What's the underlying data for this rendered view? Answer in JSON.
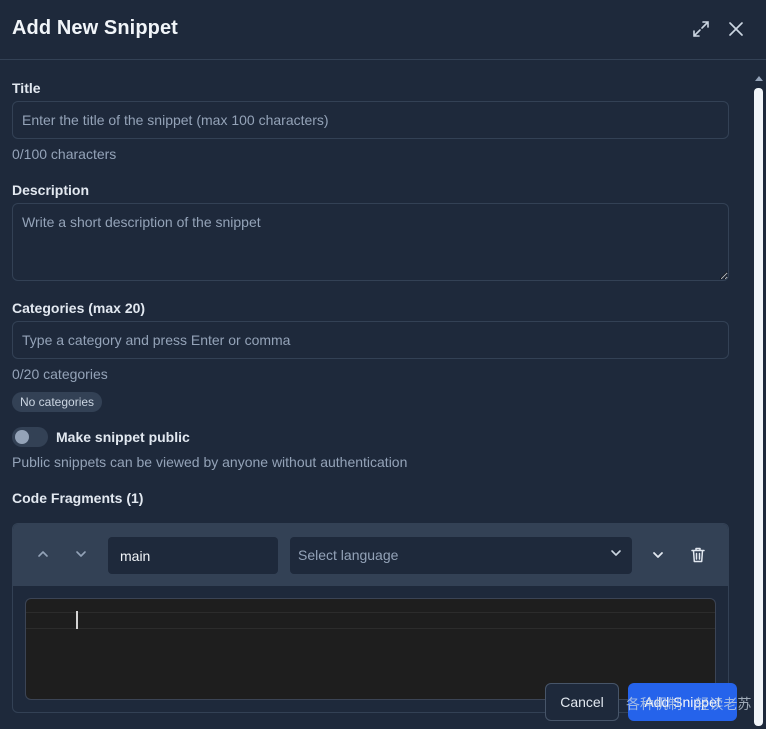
{
  "modal": {
    "title": "Add New Snippet"
  },
  "fields": {
    "title": {
      "label": "Title",
      "value": "",
      "placeholder": "Enter the title of the snippet (max 100 characters)",
      "counter": "0/100 characters"
    },
    "description": {
      "label": "Description",
      "value": "",
      "placeholder": "Write a short description of the snippet"
    },
    "categories": {
      "label": "Categories (max 20)",
      "value": "",
      "placeholder": "Type a category and press Enter or comma",
      "counter": "0/20 categories",
      "empty_chip": "No categories"
    },
    "public": {
      "label": "Make snippet public",
      "checked": false,
      "help": "Public snippets can be viewed by anyone without authentication"
    }
  },
  "fragments": {
    "heading": "Code Fragments (1)",
    "items": [
      {
        "name": "main",
        "language_placeholder": "Select language",
        "code": ""
      }
    ]
  },
  "footer": {
    "cancel_label": "Cancel",
    "add_label": "Add Snippet"
  },
  "overlay": {
    "watermark": "各种机制 · 轻读老苏"
  },
  "colors": {
    "background": "#1e293b",
    "border": "#334155",
    "primary": "#2563eb",
    "muted_text": "#94a3b8"
  },
  "icons": {
    "maximize": "expand-icon",
    "close": "close-icon",
    "move_up": "chevron-up-icon",
    "move_down": "chevron-down-icon",
    "collapse": "chevron-down-icon",
    "delete": "trash-icon"
  }
}
